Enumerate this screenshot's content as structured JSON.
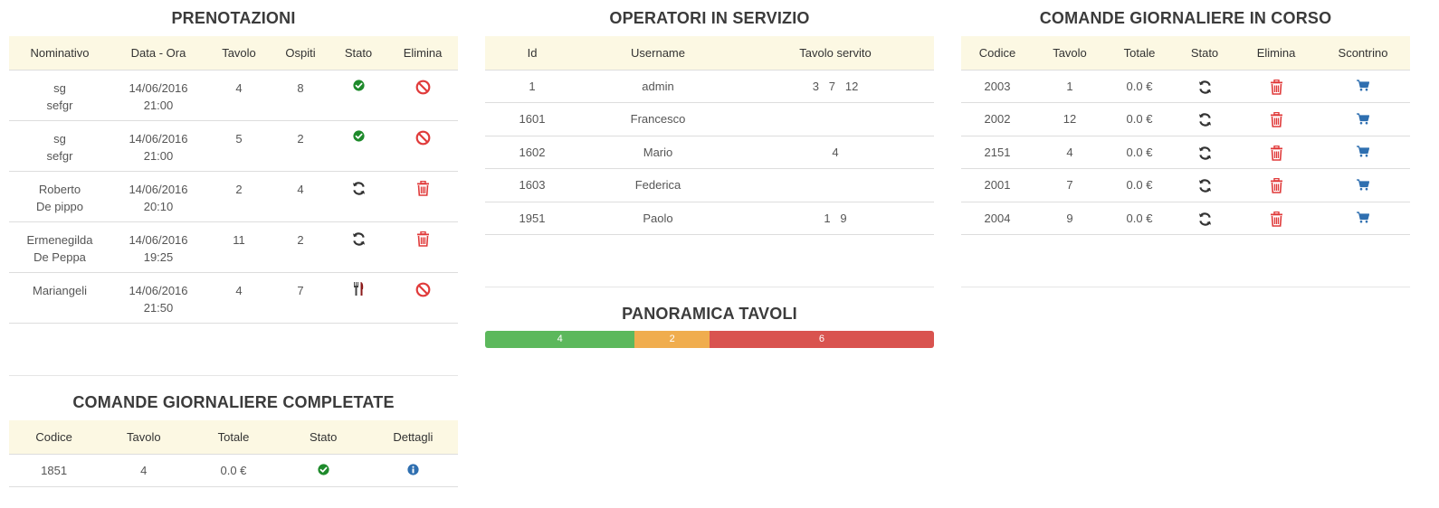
{
  "colors": {
    "header_bg": "#fcf8e3",
    "green": "#1e8a2b",
    "red": "#e03a3a",
    "blue": "#2f6fb0",
    "bar_green": "#5cb85c",
    "bar_orange": "#f0ad4e",
    "bar_red": "#d9534f"
  },
  "prenotazioni": {
    "title": "PRENOTAZIONI",
    "headers": [
      "Nominativo",
      "Data - Ora",
      "Tavolo",
      "Ospiti",
      "Stato",
      "Elimina"
    ],
    "rows": [
      {
        "name1": "sg",
        "name2": "sefgr",
        "date": "14/06/2016",
        "time": "21:00",
        "tavolo": "4",
        "ospiti": "8",
        "stato_icon": "check-circle-icon",
        "elimina_icon": "ban-icon"
      },
      {
        "name1": "sg",
        "name2": "sefgr",
        "date": "14/06/2016",
        "time": "21:00",
        "tavolo": "5",
        "ospiti": "2",
        "stato_icon": "check-circle-icon",
        "elimina_icon": "ban-icon"
      },
      {
        "name1": "Roberto",
        "name2": "De pippo",
        "date": "14/06/2016",
        "time": "20:10",
        "tavolo": "2",
        "ospiti": "4",
        "stato_icon": "refresh-icon",
        "elimina_icon": "trash-icon"
      },
      {
        "name1": "Ermenegilda",
        "name2": "De Peppa",
        "date": "14/06/2016",
        "time": "19:25",
        "tavolo": "11",
        "ospiti": "2",
        "stato_icon": "refresh-icon",
        "elimina_icon": "trash-icon"
      },
      {
        "name1": "Mariangeli",
        "name2": "",
        "date": "14/06/2016",
        "time": "21:50",
        "tavolo": "4",
        "ospiti": "7",
        "stato_icon": "cutlery-icon",
        "elimina_icon": "ban-icon"
      }
    ]
  },
  "operatori": {
    "title": "OPERATORI IN SERVIZIO",
    "headers": [
      "Id",
      "Username",
      "Tavolo servito"
    ],
    "rows": [
      {
        "id": "1",
        "username": "admin",
        "tavoli": "3   7   12"
      },
      {
        "id": "1601",
        "username": "Francesco",
        "tavoli": ""
      },
      {
        "id": "1602",
        "username": "Mario",
        "tavoli": "4"
      },
      {
        "id": "1603",
        "username": "Federica",
        "tavoli": ""
      },
      {
        "id": "1951",
        "username": "Paolo",
        "tavoli": "1   9"
      }
    ]
  },
  "panoramica": {
    "title": "PANORAMICA TAVOLI",
    "segments": [
      {
        "label": "4",
        "value": 4,
        "color": "#5cb85c"
      },
      {
        "label": "2",
        "value": 2,
        "color": "#f0ad4e"
      },
      {
        "label": "6",
        "value": 6,
        "color": "#d9534f"
      }
    ]
  },
  "in_corso": {
    "title": "COMANDE GIORNALIERE IN CORSO",
    "headers": [
      "Codice",
      "Tavolo",
      "Totale",
      "Stato",
      "Elimina",
      "Scontrino"
    ],
    "rows": [
      {
        "codice": "2003",
        "tavolo": "1",
        "totale": "0.0 €"
      },
      {
        "codice": "2002",
        "tavolo": "12",
        "totale": "0.0 €"
      },
      {
        "codice": "2151",
        "tavolo": "4",
        "totale": "0.0 €"
      },
      {
        "codice": "2001",
        "tavolo": "7",
        "totale": "0.0 €"
      },
      {
        "codice": "2004",
        "tavolo": "9",
        "totale": "0.0 €"
      }
    ]
  },
  "completate": {
    "title": "COMANDE GIORNALIERE COMPLETATE",
    "headers": [
      "Codice",
      "Tavolo",
      "Totale",
      "Stato",
      "Dettagli"
    ],
    "rows": [
      {
        "codice": "1851",
        "tavolo": "4",
        "totale": "0.0 €"
      }
    ]
  }
}
